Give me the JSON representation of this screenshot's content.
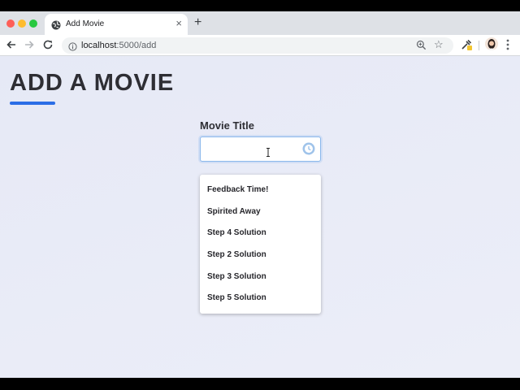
{
  "browser": {
    "tab_title": "Add Movie",
    "tab_close": "×",
    "new_tab": "+",
    "url_host": "localhost",
    "url_path": ":5000/add"
  },
  "page": {
    "heading": "ADD A MOVIE",
    "field_label": "Movie Title",
    "input_value": "",
    "autocomplete": [
      "Feedback Time!",
      "Spirited Away",
      "Step 4 Solution",
      "Step 2 Solution",
      "Step 3 Solution",
      "Step 5 Solution"
    ]
  },
  "colors": {
    "accent": "#2b6ee6",
    "focus_border": "#8bb8ec",
    "page_bg": "#e8ebf6"
  },
  "icons": [
    "globe-icon",
    "back-arrow-icon",
    "forward-arrow-icon",
    "reload-icon",
    "info-icon",
    "zoom-icon",
    "star-icon",
    "eyedropper-icon",
    "avatar",
    "menu-icon",
    "text-cursor-icon",
    "history-icon"
  ]
}
